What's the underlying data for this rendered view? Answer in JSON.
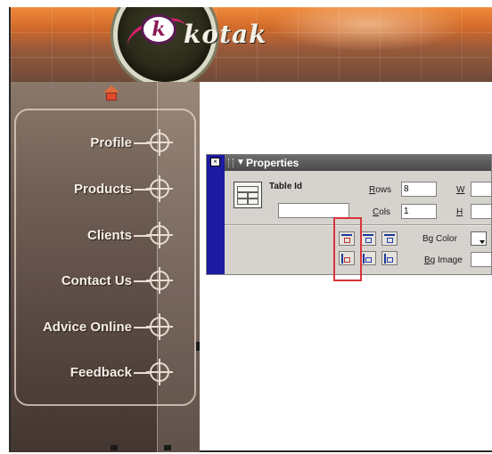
{
  "banner": {
    "logo_letter": "k",
    "logo_word": "kotak"
  },
  "sidebar": {
    "items": [
      {
        "label": "Profile"
      },
      {
        "label": "Products"
      },
      {
        "label": "Clients"
      },
      {
        "label": "Contact Us"
      },
      {
        "label": "Advice Online"
      },
      {
        "label": "Feedback"
      }
    ]
  },
  "properties": {
    "title": "Properties",
    "close_glyph": "×",
    "table_id_label": "Table Id",
    "table_id_value": "",
    "rows_label_key": "R",
    "rows_label_rest": "ows",
    "rows_value": "8",
    "cols_label_key": "C",
    "cols_label_rest": "ols",
    "cols_value": "1",
    "w_label": "W",
    "h_label": "H",
    "w_value": "",
    "h_value": "",
    "bg_color_label": "Bg Color",
    "bg_image_label_key": "B",
    "bg_image_label_rest": "g Image",
    "bg_image_value": ""
  },
  "colors": {
    "panel_accent": "#1c1aa0",
    "highlight": "#d8343a",
    "banner_orange": "#f08a3a"
  }
}
